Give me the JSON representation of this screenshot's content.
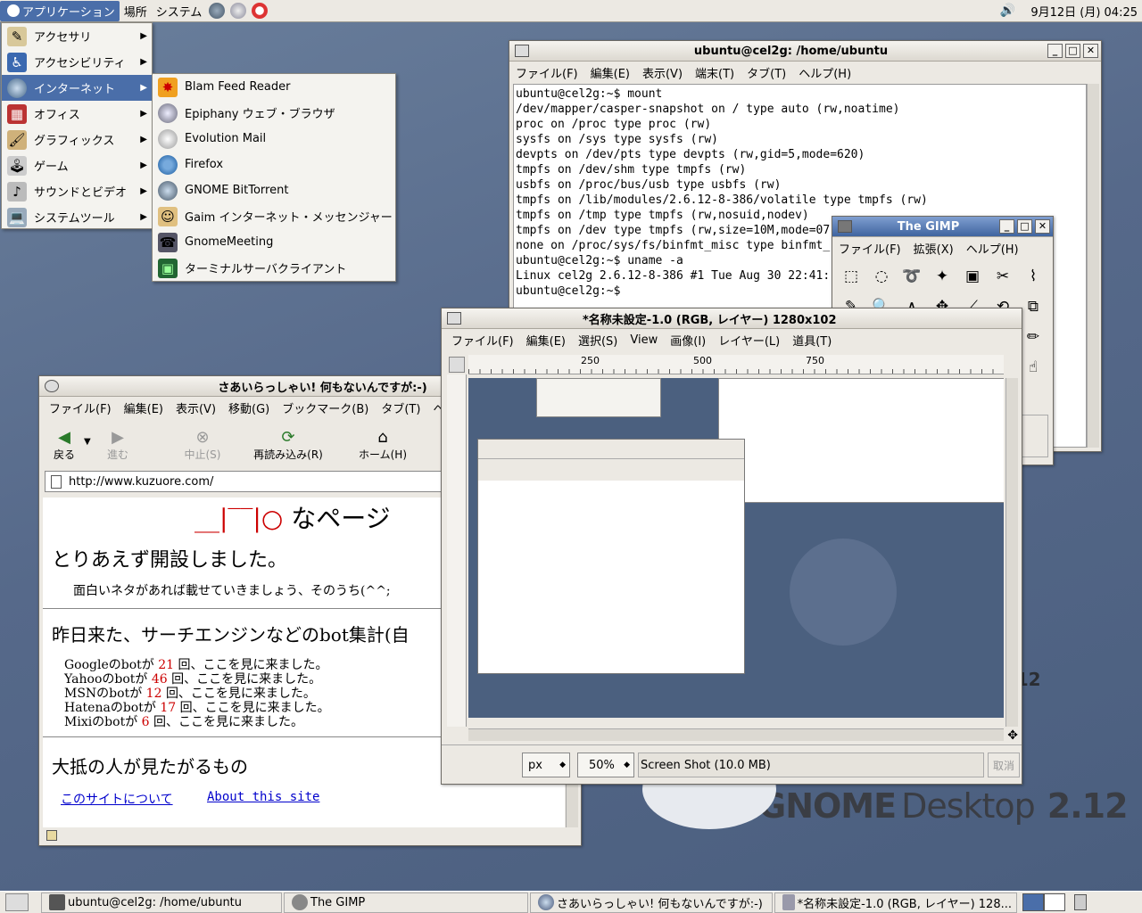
{
  "top_panel": {
    "applications": "アプリケーション",
    "places": "場所",
    "system": "システム",
    "clock": "9月12日 (月) 04:25"
  },
  "app_menu": [
    {
      "label": "アクセサリ",
      "icon": "accessories-icon"
    },
    {
      "label": "アクセシビリティ",
      "icon": "accessibility-icon"
    },
    {
      "label": "インターネット",
      "icon": "internet-icon"
    },
    {
      "label": "オフィス",
      "icon": "office-icon"
    },
    {
      "label": "グラフィックス",
      "icon": "graphics-icon"
    },
    {
      "label": "ゲーム",
      "icon": "games-icon"
    },
    {
      "label": "サウンドとビデオ",
      "icon": "sound-video-icon"
    },
    {
      "label": "システムツール",
      "icon": "system-tools-icon"
    }
  ],
  "internet_menu": [
    "Blam Feed Reader",
    "Epiphany ウェブ・ブラウザ",
    "Evolution Mail",
    "Firefox",
    "GNOME BitTorrent",
    "Gaim インターネット・メッセンジャー",
    "GnomeMeeting",
    "ターミナルサーバクライアント"
  ],
  "terminal": {
    "title": "ubuntu@cel2g: /home/ubuntu",
    "menu": [
      "ファイル(F)",
      "編集(E)",
      "表示(V)",
      "端末(T)",
      "タブ(T)",
      "ヘルプ(H)"
    ],
    "text": "ubuntu@cel2g:~$ mount\n/dev/mapper/casper-snapshot on / type auto (rw,noatime)\nproc on /proc type proc (rw)\nsysfs on /sys type sysfs (rw)\ndevpts on /dev/pts type devpts (rw,gid=5,mode=620)\ntmpfs on /dev/shm type tmpfs (rw)\nusbfs on /proc/bus/usb type usbfs (rw)\ntmpfs on /lib/modules/2.6.12-8-386/volatile type tmpfs (rw)\ntmpfs on /tmp type tmpfs (rw,nosuid,nodev)\ntmpfs on /dev type tmpfs (rw,size=10M,mode=07\nnone on /proc/sys/fs/binfmt_misc type binfmt_\nubuntu@cel2g:~$ uname -a\nLinux cel2g 2.6.12-8-386 #1 Tue Aug 30 22:41:\nubuntu@cel2g:~$ "
  },
  "toolbox": {
    "title": "The GIMP",
    "menu": [
      "ファイル(F)",
      "拡張(X)",
      "ヘルプ(H)"
    ]
  },
  "gimp_image": {
    "title": "*名称未設定-1.0 (RGB, レイヤー) 1280x102",
    "menu": [
      "ファイル(F)",
      "編集(E)",
      "選択(S)",
      "View",
      "画像(I)",
      "レイヤー(L)",
      "道具(T)"
    ],
    "ruler": [
      "250",
      "500",
      "750"
    ],
    "unit": "px",
    "zoom": "50%",
    "status": "Screen Shot (10.0 MB)",
    "cancel": "取消"
  },
  "browser": {
    "title": "さあいらっしゃい! 何もないんですが:-)",
    "menu": [
      "ファイル(F)",
      "編集(E)",
      "表示(V)",
      "移動(G)",
      "ブックマーク(B)",
      "タブ(T)",
      "ヘ"
    ],
    "back": "戻る",
    "forward": "進む",
    "stop": "中止(S)",
    "reload": "再読み込み(R)",
    "home": "ホーム(H)",
    "url": "http://www.kuzuore.com/",
    "logo_suffix": "なページ",
    "h1": "とりあえず開設しました。",
    "p1": "面白いネタがあれば載せていきましょう、そのうち(^^;",
    "h2": "昨日来た、サーチエンジンなどのbot集計(自",
    "bots": [
      {
        "name": "Googleのbotが",
        "count": "21",
        "rest": "回、ここを見に来ました。"
      },
      {
        "name": "Yahooのbotが",
        "count": "46",
        "rest": "回、ここを見に来ました。"
      },
      {
        "name": "MSNのbotが",
        "count": "12",
        "rest": "回、ここを見に来ました。"
      },
      {
        "name": "Hatenaのbotが",
        "count": "17",
        "rest": "回、ここを見に来ました。"
      },
      {
        "name": "Mixiのbotが",
        "count": "6",
        "rest": "回、ここを見に来ました。"
      }
    ],
    "h3": "大抵の人が見たがるもの",
    "link1": "このサイトについて",
    "link2": "About this site"
  },
  "taskbar": [
    "ubuntu@cel2g: /home/ubuntu",
    "The GIMP",
    "さあいらっしゃい! 何もないんですが:-)",
    "*名称未設定-1.0 (RGB, レイヤー) 128..."
  ],
  "desktop": {
    "brand1": "GNOME",
    "brand2": "Desktop",
    "version": "2.12"
  },
  "colors": {
    "accent": "#4a6ea9",
    "count_red": "#cc0000",
    "link": "#0000cc"
  }
}
